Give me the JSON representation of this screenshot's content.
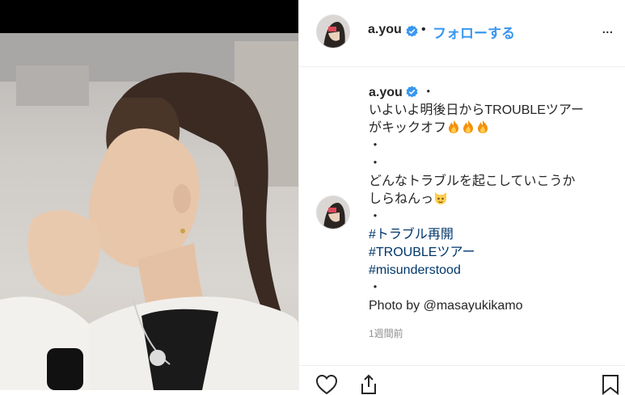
{
  "post": {
    "username": "a.you",
    "follow_label": "フォローする",
    "separator": "•",
    "more_label": "...",
    "colors": {
      "accent": "#3897f0",
      "hashtag": "#00376b",
      "muted": "#8e8e8e"
    }
  },
  "caption": {
    "username": "a.you",
    "after_username": "・",
    "line1": "いよいよ明後日からTROUBLEツアー",
    "line2": "がキックオフ",
    "line2_emoji": "fire-emoji x3",
    "dot1": "・",
    "dot2": "・",
    "line3": "どんなトラブルを起こしていこうか",
    "line4": "しらねんっ",
    "line4_emoji": "cat-face-emoji",
    "dot3": "・",
    "hashtag1": "#トラブル再開",
    "hashtag2": "#TROUBLEツアー",
    "hashtag3": "#misunderstood",
    "dot4": "・",
    "photo_by": "Photo by ",
    "mention": "@masayukikamo"
  },
  "meta": {
    "timestamp": "1週間前"
  },
  "icons": [
    "verified-badge-icon",
    "more-options-icon",
    "heart-icon",
    "share-icon",
    "save-bookmark-icon"
  ]
}
